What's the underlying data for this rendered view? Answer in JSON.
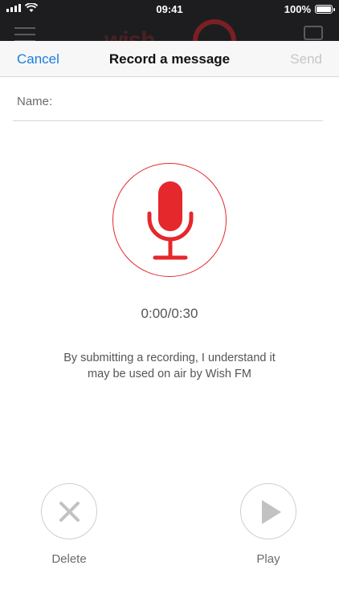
{
  "status_bar": {
    "time": "09:41",
    "battery": "100%",
    "battery_level": 1.0
  },
  "app_bar": {
    "logo_text": "wish"
  },
  "nav": {
    "cancel_label": "Cancel",
    "title": "Record a message",
    "send_label": "Send"
  },
  "form": {
    "name_label": "Name:",
    "name_value": "",
    "name_placeholder": ""
  },
  "recorder": {
    "timer": "0:00/0:30"
  },
  "disclaimer": {
    "line1": "By submitting a recording, I understand it",
    "line2": "may be used on air by Wish FM"
  },
  "actions": {
    "delete_label": "Delete",
    "play_label": "Play"
  },
  "colors": {
    "accent": "#1a7ee0",
    "record_red": "#e4282c",
    "disabled": "#c6c6c8",
    "muted_text": "#6b6b6b"
  }
}
